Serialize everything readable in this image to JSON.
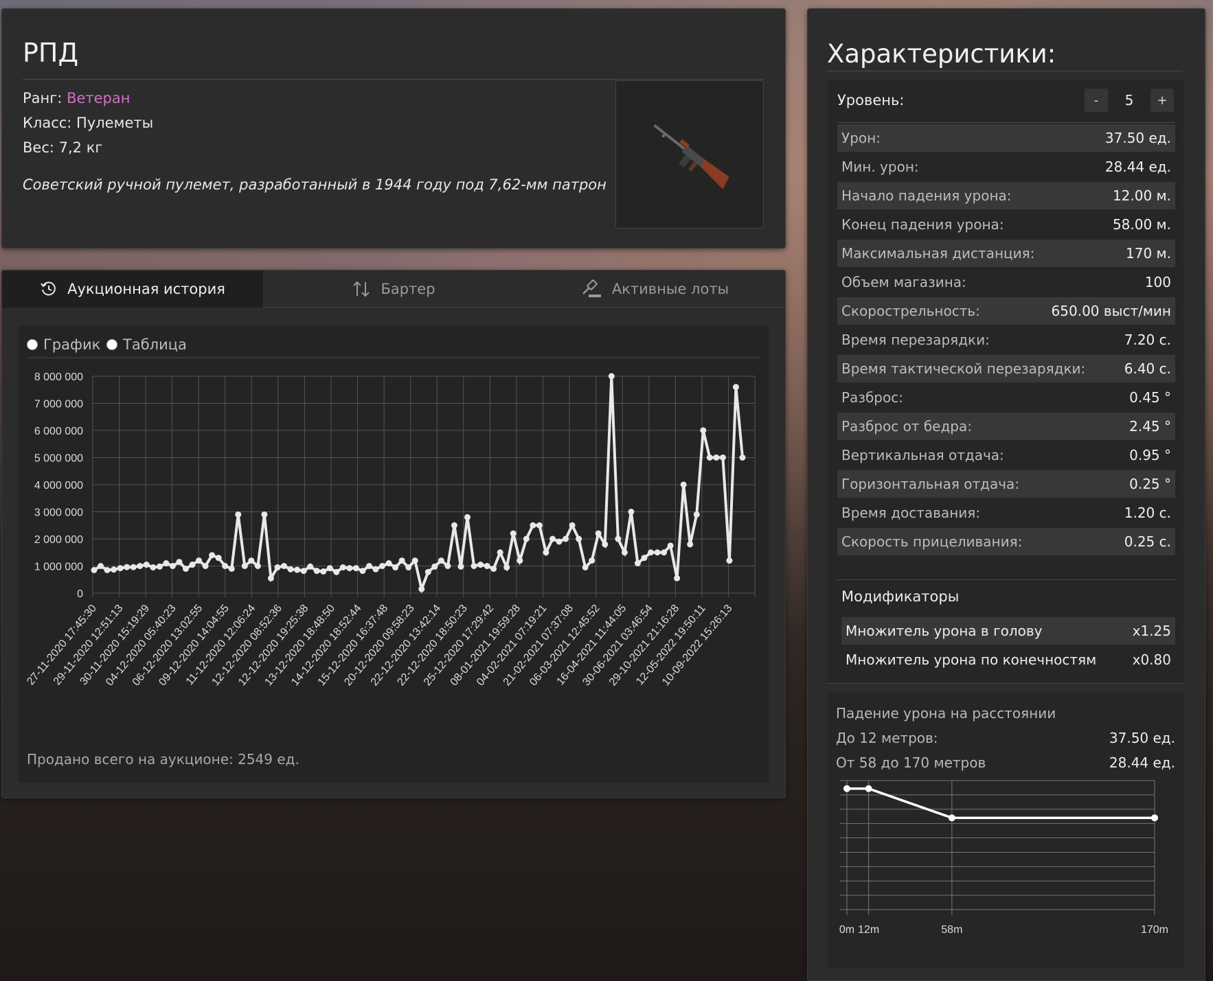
{
  "item": {
    "name": "РПД",
    "rank_label": "Ранг:",
    "rank_value": "Ветеран",
    "class_line": "Класс: Пулеметы",
    "weight_line": "Вес: 7,2 кг",
    "description": "Советский ручной пулемет, разработанный в 1944 году под 7,62-мм патрон",
    "rank_color": "#d070c8"
  },
  "tabs": [
    {
      "label": "Аукционная история",
      "icon": "history-icon",
      "active": true
    },
    {
      "label": "Бартер",
      "icon": "swap-arrows-icon",
      "active": false
    },
    {
      "label": "Активные лоты",
      "icon": "auction-hammer-icon",
      "active": false
    }
  ],
  "view_options": {
    "chart": "График",
    "table": "Таблица"
  },
  "sold_total": "Продано всего на аукционе: 2549 ед.",
  "chart_data": [
    {
      "type": "line",
      "title": "",
      "xlabel": "",
      "ylabel": "",
      "ylim": [
        0,
        8000000
      ],
      "yticks": [
        "8 000 000",
        "7 000 000",
        "6 000 000",
        "5 000 000",
        "4 000 000",
        "3 000 000",
        "2 000 000",
        "1 000 000",
        "0"
      ],
      "xtick_labels": [
        "27-11-2020 17:45:30",
        "29-11-2020 12:51:13",
        "30-11-2020 15:19:29",
        "04-12-2020 05:40:23",
        "06-12-2020 13:02:55",
        "09-12-2020 14:04:55",
        "11-12-2020 12:06:24",
        "12-12-2020 08:52:36",
        "12-12-2020 19:25:38",
        "13-12-2020 18:48:50",
        "14-12-2020 18:52:44",
        "15-12-2020 16:37:48",
        "20-12-2020 09:58:23",
        "22-12-2020 13:42:14",
        "22-12-2020 18:50:23",
        "25-12-2020 17:29:42",
        "08-01-2021 19:59:28",
        "04-02-2021 07:19:21",
        "21-02-2021 07:37:08",
        "06-03-2021 12:45:52",
        "16-04-2021 11:44:05",
        "30-06-2021 03:46:54",
        "29-10-2021 21:16:28",
        "12-05-2022 19:50:11",
        "10-09-2022 15:26:13"
      ],
      "grid": true,
      "series": [
        {
          "values": [
            850000,
            1000000,
            850000,
            870000,
            920000,
            960000,
            960000,
            1000000,
            1050000,
            950000,
            980000,
            1100000,
            1000000,
            1150000,
            900000,
            1050000,
            1200000,
            1000000,
            1400000,
            1300000,
            1000000,
            900000,
            2900000,
            1000000,
            1200000,
            1000000,
            2900000,
            550000,
            950000,
            1000000,
            880000,
            860000,
            820000,
            980000,
            820000,
            800000,
            920000,
            780000,
            950000,
            920000,
            920000,
            820000,
            1000000,
            880000,
            1000000,
            1100000,
            950000,
            1200000,
            950000,
            1200000,
            150000,
            780000,
            980000,
            1200000,
            1000000,
            2500000,
            980000,
            2800000,
            1000000,
            1050000,
            1000000,
            900000,
            1500000,
            950000,
            2200000,
            1200000,
            2000000,
            2500000,
            2500000,
            1500000,
            2000000,
            1900000,
            2000000,
            2500000,
            2000000,
            950000,
            1200000,
            2200000,
            1800000,
            8000000,
            2000000,
            1500000,
            3000000,
            1100000,
            1300000,
            1500000,
            1500000,
            1500000,
            1750000,
            550000,
            4000000,
            1800000,
            2900000,
            6000000,
            5000000,
            5000000,
            5000000,
            1200000,
            7600000,
            5000000
          ],
          "color": "#e8e8e8"
        }
      ]
    },
    {
      "type": "line",
      "title": "",
      "xlabel": "",
      "ylabel": "",
      "categories": [
        "0m",
        "12m",
        "58m",
        "170m"
      ],
      "series": [
        {
          "values": [
            37.5,
            37.5,
            28.44,
            28.44
          ],
          "color": "#ffffff"
        }
      ],
      "grid": true
    }
  ],
  "stats": {
    "title": "Характеристики:",
    "level_label": "Уровень:",
    "level_minus": "-",
    "level_value": "5",
    "level_plus": "+",
    "rows": [
      {
        "label": "Урон:",
        "value": "37.50 ед."
      },
      {
        "label": "Мин. урон:",
        "value": "28.44 ед."
      },
      {
        "label": "Начало падения урона:",
        "value": "12.00 м."
      },
      {
        "label": "Конец падения урона:",
        "value": "58.00 м."
      },
      {
        "label": "Максимальная дистанция:",
        "value": "170 м."
      },
      {
        "label": "Объем магазина:",
        "value": "100"
      },
      {
        "label": "Скорострельность:",
        "value": "650.00 выст/мин"
      },
      {
        "label": "Время перезарядки:",
        "value": "7.20 с."
      },
      {
        "label": "Время тактической перезарядки:",
        "value": "6.40 с."
      },
      {
        "label": "Разброс:",
        "value": "0.45 °"
      },
      {
        "label": "Разброс от бедра:",
        "value": "2.45 °"
      },
      {
        "label": "Вертикальная отдача:",
        "value": "0.95 °"
      },
      {
        "label": "Горизонтальная отдача:",
        "value": "0.25 °"
      },
      {
        "label": "Время доставания:",
        "value": "1.20 с."
      },
      {
        "label": "Скорость прицеливания:",
        "value": "0.25 с."
      }
    ],
    "modifiers_title": "Модификаторы",
    "modifiers": [
      {
        "label": "Множитель урона в голову",
        "value": "x1.25"
      },
      {
        "label": "Множитель урона по конечностям",
        "value": "x0.80"
      }
    ]
  },
  "falloff": {
    "title": "Падение урона на расстоянии",
    "rows": [
      {
        "label": "До 12 метров:",
        "value": "37.50 ед."
      },
      {
        "label": "От 58 до 170 метров",
        "value": "28.44 ед."
      }
    ]
  }
}
